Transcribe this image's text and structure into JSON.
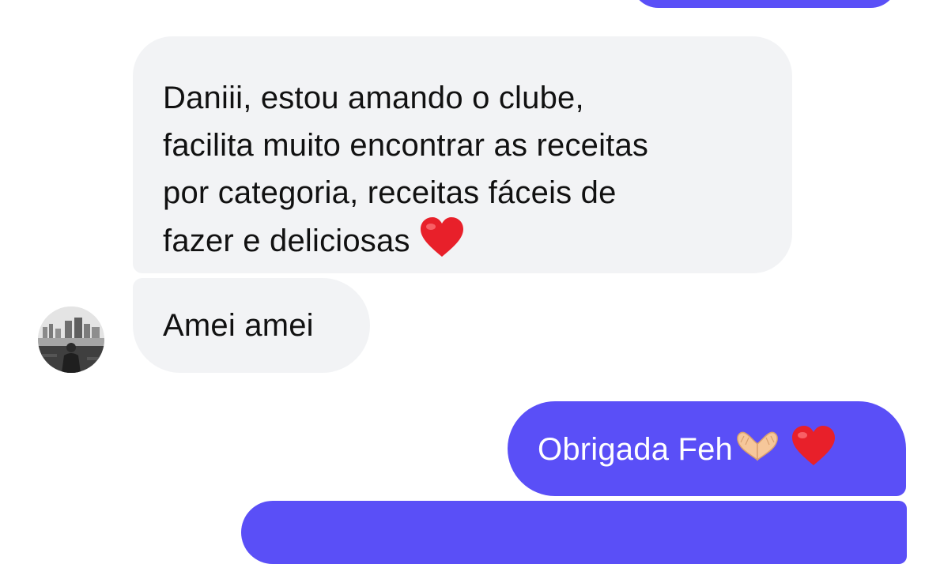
{
  "conversation": {
    "messages": [
      {
        "direction": "incoming",
        "text": "Daniii, estou amando o clube,\nfacilita muito encontrar as receitas\npor  categoria,  receitas fáceis de\nfazer e deliciosas",
        "emoji": "red-heart"
      },
      {
        "direction": "incoming",
        "text": "Amei amei"
      },
      {
        "direction": "outgoing",
        "text": "Obrigada Feh",
        "emoji": [
          "heart-hands",
          "red-heart"
        ]
      }
    ],
    "sender_avatar": "contact-avatar-photo"
  },
  "colors": {
    "incoming_bubble": "#f2f3f5",
    "outgoing_bubble": "#5a4ff7",
    "incoming_text": "#111111",
    "outgoing_text": "#ffffff",
    "heart": "#e8202a"
  }
}
